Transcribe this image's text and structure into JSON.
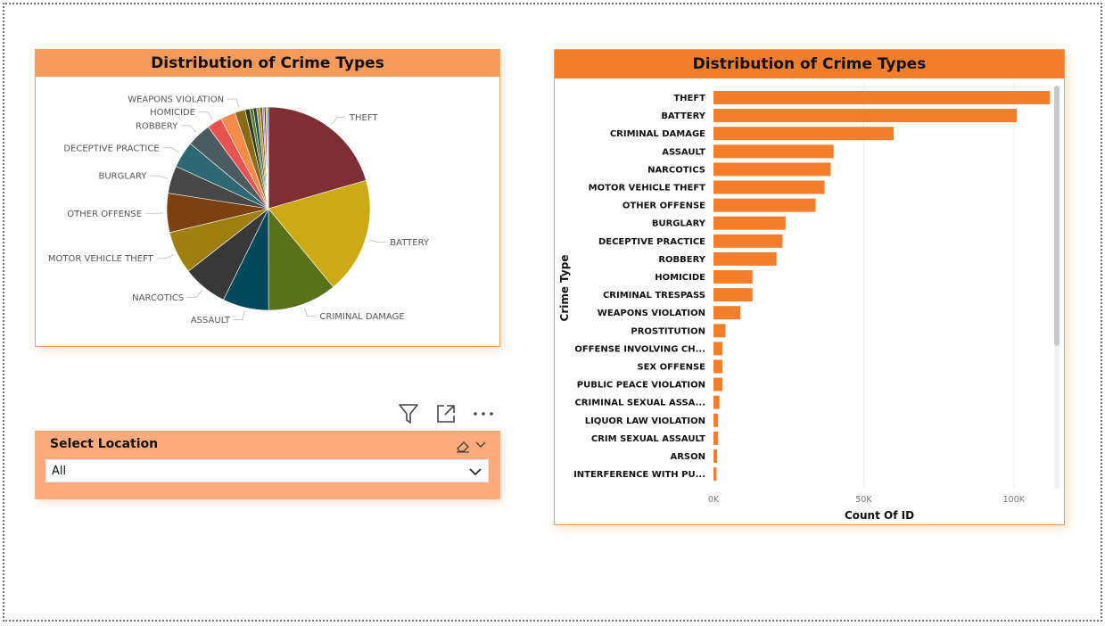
{
  "slicer": {
    "title": "Select Location",
    "value": "All"
  },
  "toolbar": {
    "icons": [
      "filter-icon",
      "focus-mode-icon",
      "more-options-icon"
    ]
  },
  "colors": {
    "accent": "#f27d2b",
    "pie_header": "#f49a5b",
    "slicer_bg": "#fdaa7c"
  },
  "chart_data": [
    {
      "type": "pie",
      "title": "Distribution of Crime Types",
      "categories": [
        "THEFT",
        "BATTERY",
        "CRIMINAL DAMAGE",
        "ASSAULT",
        "NARCOTICS",
        "MOTOR VEHICLE THEFT",
        "OTHER OFFENSE",
        "BURGLARY",
        "DECEPTIVE PRACTICE",
        "ROBBERY",
        "HOMICIDE",
        "CRIMINAL TRESPASS",
        "WEAPONS VIOLATION",
        "PROSTITUTION",
        "OFFENSE INVOLVING CHILDREN",
        "SEX OFFENSE",
        "PUBLIC PEACE VIOLATION",
        "CRIMINAL SEXUAL ASSAULT",
        "LIQUOR LAW VIOLATION",
        "CRIM SEXUAL ASSAULT",
        "ARSON",
        "INTERFERENCE WITH PUBLIC OFFICER"
      ],
      "values": [
        112000,
        101000,
        60000,
        40000,
        39000,
        37000,
        34000,
        24000,
        23000,
        21000,
        13000,
        13000,
        9000,
        4000,
        3000,
        3000,
        3000,
        2000,
        1500,
        1500,
        1200,
        1000
      ],
      "visible_labels": [
        "THEFT",
        "BATTERY",
        "CRIMINAL DAMAGE",
        "ASSAULT",
        "NARCOTICS",
        "MOTOR VEHICLE THEFT",
        "OTHER OFFENSE",
        "BURGLARY",
        "DECEPTIVE PRACTICE",
        "ROBBERY",
        "HOMICIDE",
        "WEAPONS VIOLATION"
      ],
      "colors": [
        "#7f2f34",
        "#ccaa16",
        "#577219",
        "#03495b",
        "#383838",
        "#9e7f10",
        "#7c4113",
        "#474747",
        "#2f6873",
        "#4c5b62",
        "#e8534f",
        "#f38b4b",
        "#8a6b16",
        "#2d3b1f",
        "#5a7a2a",
        "#1c4a52",
        "#b6962a",
        "#6a4a2a",
        "#9f9f9f",
        "#7e1e2e",
        "#c7a000",
        "#2a5d8f"
      ]
    },
    {
      "type": "bar",
      "orientation": "horizontal",
      "title": "Distribution of Crime Types",
      "xlabel": "Count Of ID",
      "ylabel": "Crime Type",
      "categories": [
        "THEFT",
        "BATTERY",
        "CRIMINAL DAMAGE",
        "ASSAULT",
        "NARCOTICS",
        "MOTOR VEHICLE THEFT",
        "OTHER OFFENSE",
        "BURGLARY",
        "DECEPTIVE PRACTICE",
        "ROBBERY",
        "HOMICIDE",
        "CRIMINAL TRESPASS",
        "WEAPONS VIOLATION",
        "PROSTITUTION",
        "OFFENSE INVOLVING CH...",
        "SEX OFFENSE",
        "PUBLIC PEACE VIOLATION",
        "CRIMINAL SEXUAL ASSA...",
        "LIQUOR LAW VIOLATION",
        "CRIM SEXUAL ASSAULT",
        "ARSON",
        "INTERFERENCE WITH PU..."
      ],
      "values": [
        112000,
        101000,
        60000,
        40000,
        39000,
        37000,
        34000,
        24000,
        23000,
        21000,
        13000,
        13000,
        9000,
        4000,
        3000,
        3000,
        3000,
        2000,
        1500,
        1500,
        1200,
        1000
      ],
      "xlim": [
        0,
        125000
      ],
      "xticks": [
        0,
        50000,
        100000
      ],
      "xtick_labels": [
        "0K",
        "50K",
        "100K"
      ],
      "grid": true,
      "bar_color": "#f27d2b"
    }
  ]
}
